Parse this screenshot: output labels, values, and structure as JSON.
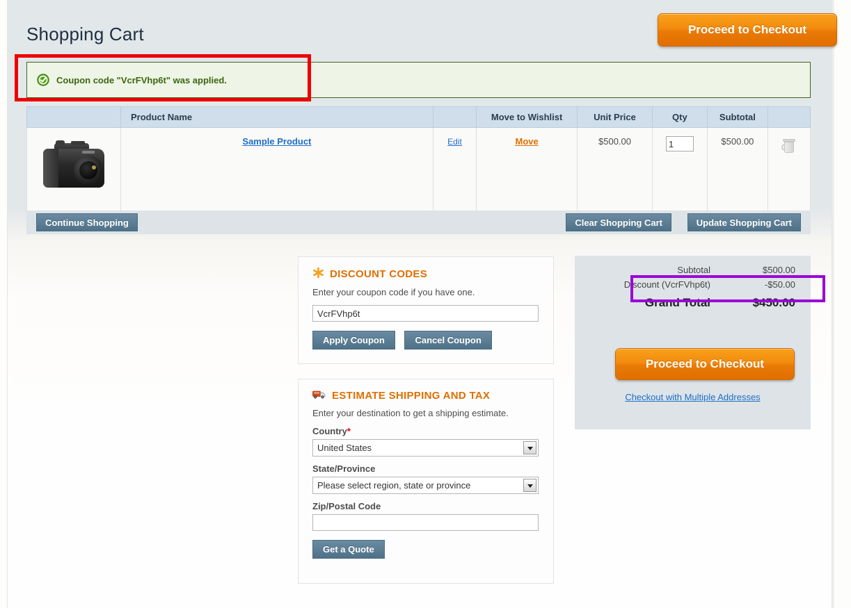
{
  "header": {
    "title": "Shopping Cart",
    "checkout_button": "Proceed to Checkout"
  },
  "notice": {
    "icon": "success-check-icon",
    "text": "Coupon code \"VcrFVhp6t\" was applied."
  },
  "cart_table": {
    "columns": {
      "image": "",
      "product_name": "Product Name",
      "edit": "",
      "move_to_wishlist": "Move to Wishlist",
      "unit_price": "Unit Price",
      "qty": "Qty",
      "subtotal": "Subtotal",
      "remove": ""
    },
    "rows": [
      {
        "image_alt": "camera-thumbnail",
        "product_name": "Sample Product",
        "edit_label": "Edit",
        "move_label": "Move",
        "unit_price": "$500.00",
        "qty": "1",
        "subtotal": "$500.00",
        "remove_icon": "trash-icon"
      }
    ]
  },
  "cart_actions": {
    "continue_shopping": "Continue Shopping",
    "clear_cart": "Clear Shopping Cart",
    "update_cart": "Update Shopping Cart"
  },
  "discount": {
    "icon": "asterisk-icon",
    "title": "DISCOUNT CODES",
    "description": "Enter your coupon code if you have one.",
    "coupon_value": "VcrFVhp6t",
    "apply_label": "Apply Coupon",
    "cancel_label": "Cancel Coupon"
  },
  "shipping": {
    "icon": "truck-icon",
    "title": "ESTIMATE SHIPPING AND TAX",
    "description": "Enter your destination to get a shipping estimate.",
    "country_label": "Country",
    "country_required": "*",
    "country_value": "United States",
    "state_label": "State/Province",
    "state_value": "Please select region, state or province",
    "zip_label": "Zip/Postal Code",
    "zip_value": "",
    "quote_label": "Get a Quote"
  },
  "totals": {
    "subtotal_label": "Subtotal",
    "subtotal_value": "$500.00",
    "discount_label": "Discount (VcrFVhp6t)",
    "discount_value": "-$50.00",
    "grand_total_label": "Grand Total",
    "grand_total_value": "$450.00",
    "checkout_button": "Proceed to Checkout",
    "multi_address_link": "Checkout with Multiple Addresses"
  },
  "annotations": {
    "red_box_color": "#ee0000",
    "purple_box_color": "#9b04d6"
  }
}
